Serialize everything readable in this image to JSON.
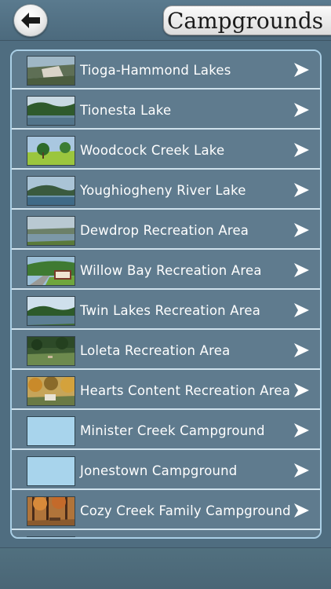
{
  "header": {
    "back_icon": "back-arrow-icon",
    "title": "Campgrounds"
  },
  "list": [
    {
      "label": "Tioga-Hammond Lakes",
      "thumb": "photo",
      "scene": "dam"
    },
    {
      "label": "Tionesta Lake",
      "thumb": "photo",
      "scene": "lake-forest"
    },
    {
      "label": "Woodcock Creek Lake",
      "thumb": "photo",
      "scene": "grass-trees"
    },
    {
      "label": "Youghiogheny River Lake",
      "thumb": "photo",
      "scene": "lake-hills"
    },
    {
      "label": "Dewdrop Recreation Area",
      "thumb": "photo",
      "scene": "lake-wide"
    },
    {
      "label": "Willow Bay Recreation Area",
      "thumb": "photo",
      "scene": "sign-road"
    },
    {
      "label": "Twin Lakes Recreation Area",
      "thumb": "photo",
      "scene": "lake-forest-sky"
    },
    {
      "label": "Loleta Recreation Area",
      "thumb": "photo",
      "scene": "field-trees"
    },
    {
      "label": "Hearts Content Recreation Area",
      "thumb": "photo",
      "scene": "autumn-camp"
    },
    {
      "label": "Minister Creek Campground",
      "thumb": "blank"
    },
    {
      "label": "Jonestown Campground",
      "thumb": "blank"
    },
    {
      "label": "Cozy Creek Family Campground",
      "thumb": "photo",
      "scene": "autumn-forest"
    },
    {
      "label": "",
      "thumb": "blank"
    }
  ],
  "chevron_icon": "chevron-right-icon",
  "colors": {
    "background": "#4f6d80",
    "row_background": "#5f7b8e",
    "row_divider": "#cfe1ec",
    "panel_border": "#aacfe6",
    "blank_thumb": "#a8d4ec"
  }
}
